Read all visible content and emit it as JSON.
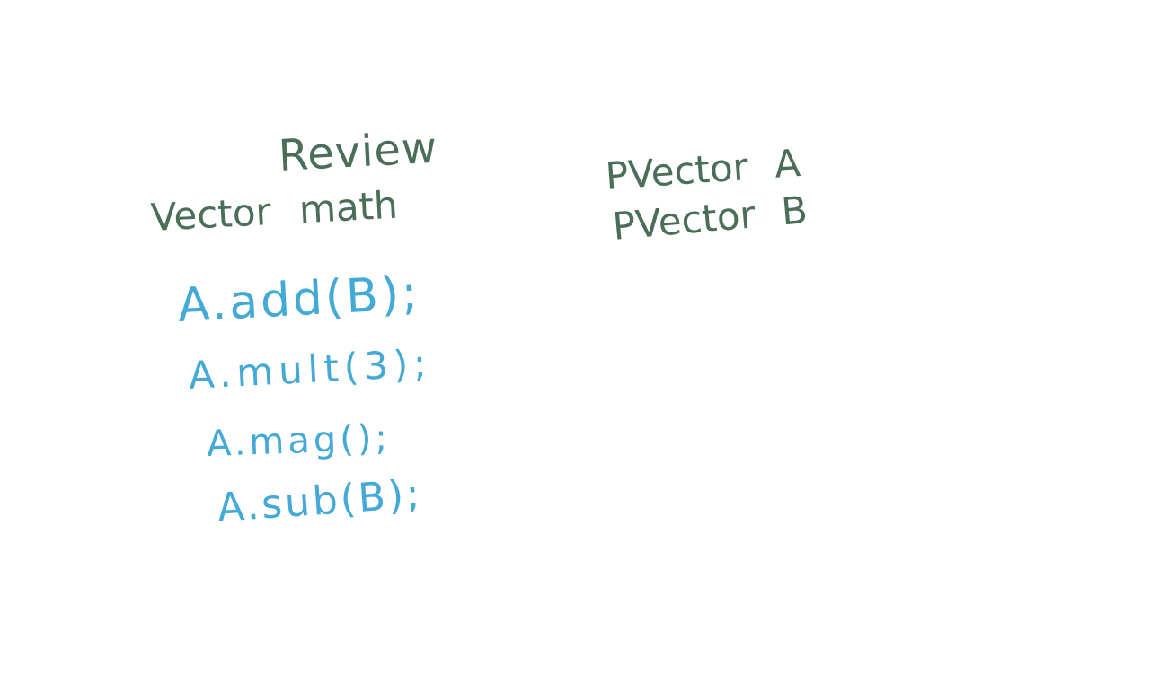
{
  "whiteboard": {
    "title": "Review",
    "subtitle": "Vector math",
    "declarations": [
      "PVector A",
      "PVector B"
    ],
    "code_lines": [
      "A.add(B);",
      "A.mult(3);",
      "A.mag();",
      "A.sub(B);"
    ],
    "colors": {
      "heading_ink": "#4a6e57",
      "code_ink": "#43a9d6",
      "background": "#ffffff"
    }
  }
}
